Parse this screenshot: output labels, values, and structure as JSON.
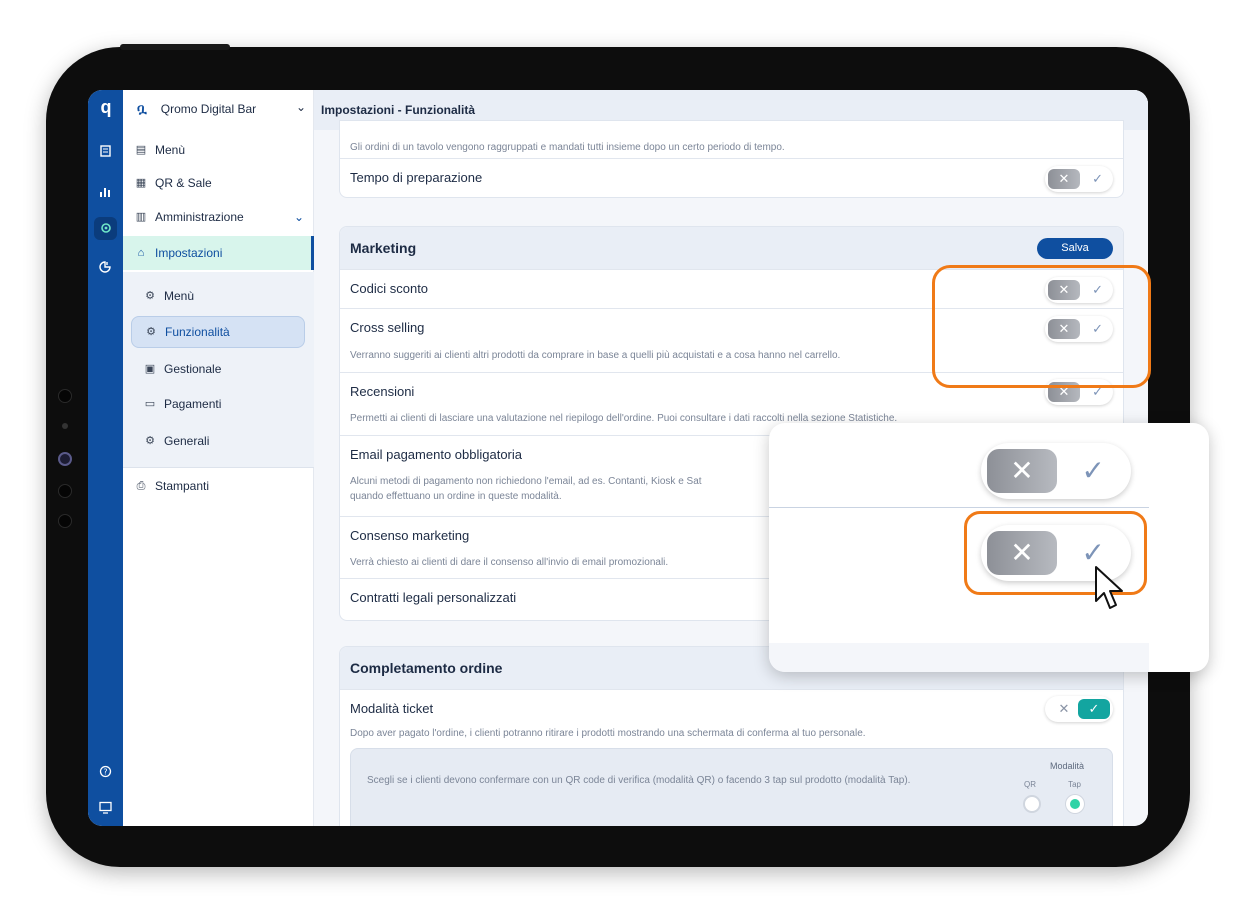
{
  "app": {
    "venue_name": "Qromo Digital Bar",
    "page_title": "Impostazioni - Funzionalità"
  },
  "rail": {
    "logo": "q",
    "icons": [
      "orders-icon",
      "stats-icon",
      "settings-icon",
      "marketing-icon",
      "help-icon",
      "monitor-icon"
    ]
  },
  "sidebar": {
    "items": [
      {
        "label": "Menù"
      },
      {
        "label": "QR & Sale"
      },
      {
        "label": "Amministrazione"
      },
      {
        "label": "Impostazioni"
      }
    ],
    "sub_items": [
      {
        "label": "Menù"
      },
      {
        "label": "Funzionalità"
      },
      {
        "label": "Gestionale"
      },
      {
        "label": "Pagamenti"
      },
      {
        "label": "Generali"
      }
    ],
    "bottom_item": {
      "label": "Stampanti"
    }
  },
  "ordering_card": {
    "desc_top": "Gli ordini di un tavolo vengono raggruppati e mandati tutti insieme dopo un certo periodo di tempo.",
    "prep_time": "Tempo di preparazione"
  },
  "marketing": {
    "title": "Marketing",
    "save_label": "Salva",
    "rows": [
      {
        "title": "Codici sconto",
        "desc": ""
      },
      {
        "title": "Cross selling",
        "desc": "Verranno suggeriti ai clienti altri prodotti da comprare in base a quelli più acquistati e a cosa hanno nel carrello."
      },
      {
        "title": "Recensioni",
        "desc": "Permetti ai clienti di lasciare una valutazione nel riepilogo dell'ordine. Puoi consultare i dati raccolti nella sezione Statistiche."
      },
      {
        "title": "Email pagamento obbligatoria",
        "desc": "Alcuni metodi di pagamento non richiedono l'email, ad es. Contanti, Kiosk e Sat",
        "desc2": "quando effettuano un ordine in queste modalità."
      },
      {
        "title": "Consenso marketing",
        "desc": "Verrà chiesto ai clienti di dare il consenso all'invio di email promozionali."
      },
      {
        "title": "Contratti legali personalizzati",
        "desc": ""
      }
    ]
  },
  "completion": {
    "title": "Completamento ordine",
    "ticket_title": "Modalità ticket",
    "ticket_desc": "Dopo aver pagato l'ordine, i clienti potranno ritirare i prodotti mostrando una schermata di conferma al tuo personale.",
    "mode_desc": "Scegli se i clienti devono confermare con un QR code di verifica (modalità QR) o facendo 3 tap sul prodotto (modalità Tap).",
    "mode_label": "Modalità",
    "option_qr": "QR",
    "option_tap": "Tap",
    "selected_option": "Tap"
  },
  "toggle_glyphs": {
    "off": "✕",
    "on": "✓"
  },
  "colors": {
    "brand_blue": "#0f4fa0",
    "accent_teal": "#13a5a0",
    "highlight_orange": "#f07a17",
    "selected_mint": "#d8f5ec"
  }
}
